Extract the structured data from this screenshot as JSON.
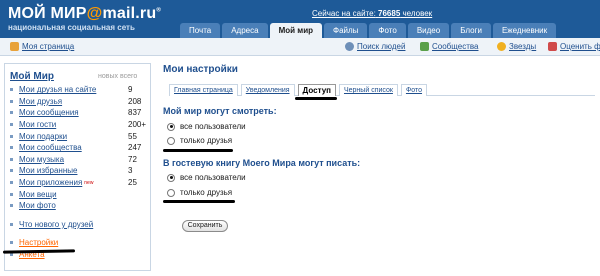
{
  "header": {
    "logo_main": "МОЙ МИР",
    "logo_at": "@",
    "logo_domain": "mail.ru",
    "logo_reg": "®",
    "logo_subtitle": "национальная социальная сеть",
    "online_prefix": "Сейчас на сайте:",
    "online_count": "76685",
    "online_suffix": "человек",
    "tabs": [
      {
        "label": "Почта",
        "active": false
      },
      {
        "label": "Адреса",
        "active": false
      },
      {
        "label": "Мой мир",
        "active": true
      },
      {
        "label": "Файлы",
        "active": false
      },
      {
        "label": "Фото",
        "active": false
      },
      {
        "label": "Видео",
        "active": false
      },
      {
        "label": "Блоги",
        "active": false
      },
      {
        "label": "Ежедневник",
        "active": false
      }
    ]
  },
  "subnav": {
    "my_page": "Моя страница",
    "search_people": "Поиск людей",
    "communities": "Сообщества",
    "stars": "Звезды",
    "rate_photo": "Оценить ф"
  },
  "sidebar": {
    "title": "Мой Мир",
    "new_all_header": "новых всего",
    "items": [
      {
        "label": "Мои друзья на сайте",
        "count": "9"
      },
      {
        "label": "Мои друзья",
        "count": "208"
      },
      {
        "label": "Мои сообщения",
        "count": "837"
      },
      {
        "label": "Мои гости",
        "count": "200+"
      },
      {
        "label": "Мои подарки",
        "count": "55"
      },
      {
        "label": "Мои сообщества",
        "count": "247"
      },
      {
        "label": "Мои музыка",
        "count": "72"
      },
      {
        "label": "Мои избранные",
        "count": "3"
      },
      {
        "label": "Мои приложения",
        "count": "25",
        "badge": "new"
      },
      {
        "label": "Мои вещи",
        "count": ""
      },
      {
        "label": "Мои фото",
        "count": ""
      }
    ],
    "whats_new": "Что нового у друзей",
    "settings": "Настройки",
    "anketa": "Анкета"
  },
  "main": {
    "title": "Мои настройки",
    "tabs": [
      {
        "label": "Главная страница",
        "active": false
      },
      {
        "label": "Уведомления",
        "active": false
      },
      {
        "label": "Доступ",
        "active": true
      },
      {
        "label": "Черный список",
        "active": false
      },
      {
        "label": "Фото",
        "active": false
      }
    ],
    "section1": {
      "heading": "Мой мир могут смотреть:",
      "options": [
        {
          "label": "все пользователи",
          "checked": true
        },
        {
          "label": "только друзья",
          "checked": false
        }
      ]
    },
    "section2": {
      "heading": "В гостевую книгу Моего Мира могут писать:",
      "options": [
        {
          "label": "все пользователи",
          "checked": true
        },
        {
          "label": "только друзья",
          "checked": false
        }
      ]
    },
    "save_label": "Сохранить"
  },
  "colors": {
    "header_bg": "#1e5a98",
    "tab_bg": "#4a7fb8",
    "link": "#1f4f8e",
    "accent_orange": "#ff6600",
    "subnav_bg": "#eef3f8"
  }
}
